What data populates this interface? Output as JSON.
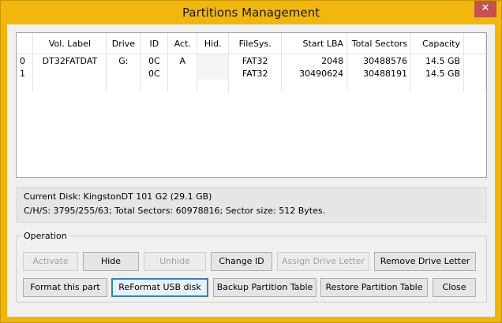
{
  "window": {
    "title": "Partitions Management",
    "close_glyph": "✕"
  },
  "table": {
    "columns": [
      "",
      "Vol. Label",
      "Drive",
      "ID",
      "Act.",
      "Hid.",
      "FileSys.",
      "Start LBA",
      "Total Sectors",
      "Capacity"
    ],
    "rows": [
      {
        "num": "0",
        "label": "DT32FATDAT",
        "drive": "G:",
        "id": "0C",
        "act": "A",
        "hid": "",
        "fs": "FAT32",
        "start": "2048",
        "total": "30488576",
        "cap": "14.5 GB"
      },
      {
        "num": "1",
        "label": "",
        "drive": "",
        "id": "0C",
        "act": "",
        "hid": "",
        "fs": "FAT32",
        "start": "30490624",
        "total": "30488191",
        "cap": "14.5 GB"
      }
    ]
  },
  "info": {
    "line1": "Current Disk:  KingstonDT 101 G2 (29.1 GB)",
    "line2": "C/H/S: 3795/255/63; Total Sectors: 60978816; Sector size: 512 Bytes."
  },
  "operation": {
    "label": "Operation",
    "buttons": {
      "activate": "Activate",
      "hide": "Hide",
      "unhide": "Unhide",
      "change_id": "Change ID",
      "assign": "Assign Drive Letter",
      "remove": "Remove Drive Letter",
      "format": "Format this part",
      "reformat": "ReFormat USB disk",
      "backup": "Backup Partition Table",
      "restore": "Restore Partition Table",
      "close": "Close"
    }
  }
}
